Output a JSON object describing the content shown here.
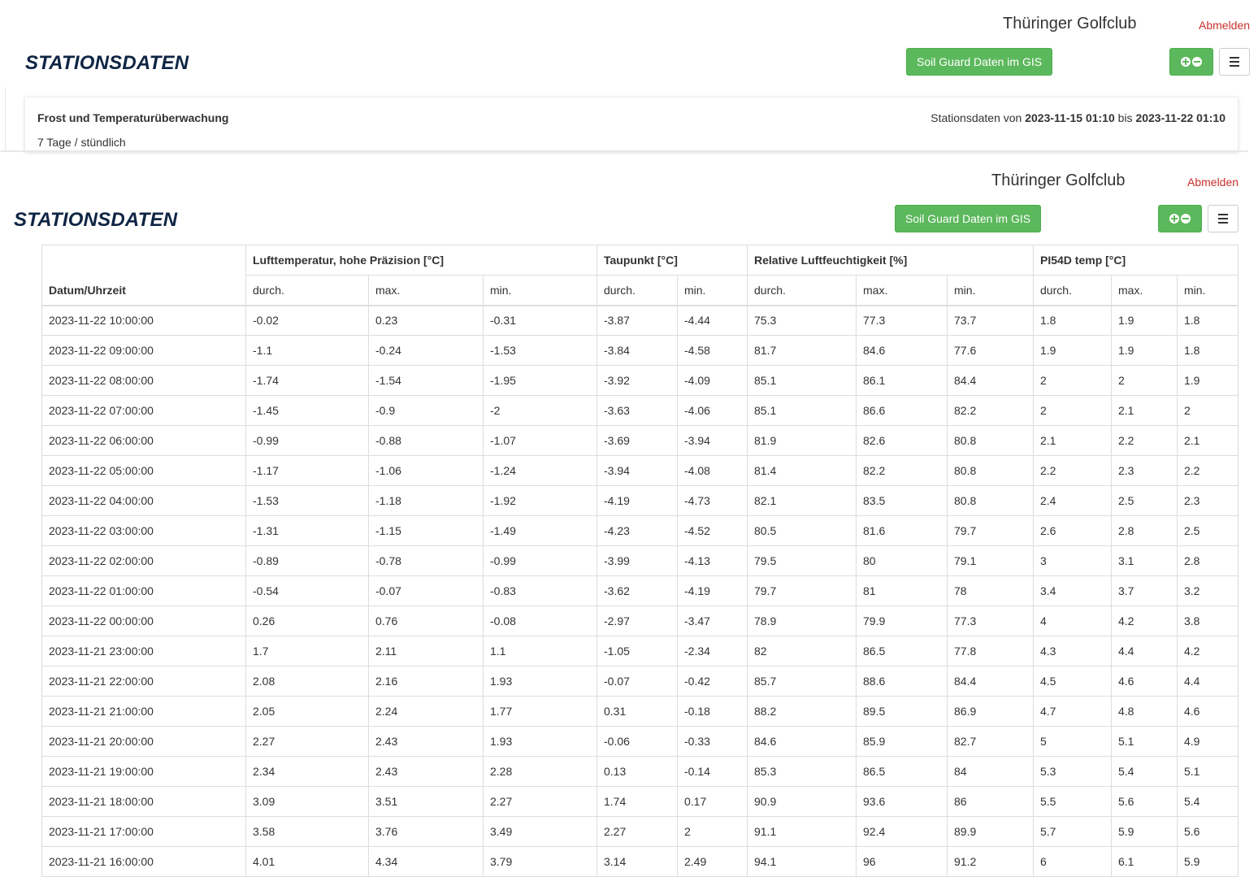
{
  "header": {
    "club_name": "Thüringer Golfclub",
    "logout": "Abmelden",
    "page_title": "STATIONSDATEN",
    "gis_button": "Soil Guard Daten im GIS"
  },
  "panel": {
    "title": "Frost und Temperaturüberwachung",
    "range_prefix": "Stationsdaten von",
    "range_from": "2023-11-15 01:10",
    "range_mid": "bis",
    "range_to": "2023-11-22 01:10",
    "subtitle": "7 Tage / stündlich"
  },
  "table": {
    "col_datetime": "Datum/Uhrzeit",
    "groups": [
      "Lufttemperatur, hohe Präzision [°C]",
      "Taupunkt [°C]",
      "Relative Luftfeuchtigkeit [%]",
      "PI54D temp [°C]"
    ],
    "sub": {
      "avg": "durch.",
      "max": "max.",
      "min": "min."
    },
    "rows": [
      [
        "2023-11-22 10:00:00",
        "-0.02",
        "0.23",
        "-0.31",
        "-3.87",
        "-4.44",
        "75.3",
        "77.3",
        "73.7",
        "1.8",
        "1.9",
        "1.8"
      ],
      [
        "2023-11-22 09:00:00",
        "-1.1",
        "-0.24",
        "-1.53",
        "-3.84",
        "-4.58",
        "81.7",
        "84.6",
        "77.6",
        "1.9",
        "1.9",
        "1.8"
      ],
      [
        "2023-11-22 08:00:00",
        "-1.74",
        "-1.54",
        "-1.95",
        "-3.92",
        "-4.09",
        "85.1",
        "86.1",
        "84.4",
        "2",
        "2",
        "1.9"
      ],
      [
        "2023-11-22 07:00:00",
        "-1.45",
        "-0.9",
        "-2",
        "-3.63",
        "-4.06",
        "85.1",
        "86.6",
        "82.2",
        "2",
        "2.1",
        "2"
      ],
      [
        "2023-11-22 06:00:00",
        "-0.99",
        "-0.88",
        "-1.07",
        "-3.69",
        "-3.94",
        "81.9",
        "82.6",
        "80.8",
        "2.1",
        "2.2",
        "2.1"
      ],
      [
        "2023-11-22 05:00:00",
        "-1.17",
        "-1.06",
        "-1.24",
        "-3.94",
        "-4.08",
        "81.4",
        "82.2",
        "80.8",
        "2.2",
        "2.3",
        "2.2"
      ],
      [
        "2023-11-22 04:00:00",
        "-1.53",
        "-1.18",
        "-1.92",
        "-4.19",
        "-4.73",
        "82.1",
        "83.5",
        "80.8",
        "2.4",
        "2.5",
        "2.3"
      ],
      [
        "2023-11-22 03:00:00",
        "-1.31",
        "-1.15",
        "-1.49",
        "-4.23",
        "-4.52",
        "80.5",
        "81.6",
        "79.7",
        "2.6",
        "2.8",
        "2.5"
      ],
      [
        "2023-11-22 02:00:00",
        "-0.89",
        "-0.78",
        "-0.99",
        "-3.99",
        "-4.13",
        "79.5",
        "80",
        "79.1",
        "3",
        "3.1",
        "2.8"
      ],
      [
        "2023-11-22 01:00:00",
        "-0.54",
        "-0.07",
        "-0.83",
        "-3.62",
        "-4.19",
        "79.7",
        "81",
        "78",
        "3.4",
        "3.7",
        "3.2"
      ],
      [
        "2023-11-22 00:00:00",
        "0.26",
        "0.76",
        "-0.08",
        "-2.97",
        "-3.47",
        "78.9",
        "79.9",
        "77.3",
        "4",
        "4.2",
        "3.8"
      ],
      [
        "2023-11-21 23:00:00",
        "1.7",
        "2.11",
        "1.1",
        "-1.05",
        "-2.34",
        "82",
        "86.5",
        "77.8",
        "4.3",
        "4.4",
        "4.2"
      ],
      [
        "2023-11-21 22:00:00",
        "2.08",
        "2.16",
        "1.93",
        "-0.07",
        "-0.42",
        "85.7",
        "88.6",
        "84.4",
        "4.5",
        "4.6",
        "4.4"
      ],
      [
        "2023-11-21 21:00:00",
        "2.05",
        "2.24",
        "1.77",
        "0.31",
        "-0.18",
        "88.2",
        "89.5",
        "86.9",
        "4.7",
        "4.8",
        "4.6"
      ],
      [
        "2023-11-21 20:00:00",
        "2.27",
        "2.43",
        "1.93",
        "-0.06",
        "-0.33",
        "84.6",
        "85.9",
        "82.7",
        "5",
        "5.1",
        "4.9"
      ],
      [
        "2023-11-21 19:00:00",
        "2.34",
        "2.43",
        "2.28",
        "0.13",
        "-0.14",
        "85.3",
        "86.5",
        "84",
        "5.3",
        "5.4",
        "5.1"
      ],
      [
        "2023-11-21 18:00:00",
        "3.09",
        "3.51",
        "2.27",
        "1.74",
        "0.17",
        "90.9",
        "93.6",
        "86",
        "5.5",
        "5.6",
        "5.4"
      ],
      [
        "2023-11-21 17:00:00",
        "3.58",
        "3.76",
        "3.49",
        "2.27",
        "2",
        "91.1",
        "92.4",
        "89.9",
        "5.7",
        "5.9",
        "5.6"
      ],
      [
        "2023-11-21 16:00:00",
        "4.01",
        "4.34",
        "3.79",
        "3.14",
        "2.49",
        "94.1",
        "96",
        "91.2",
        "6",
        "6.1",
        "5.9"
      ]
    ]
  }
}
